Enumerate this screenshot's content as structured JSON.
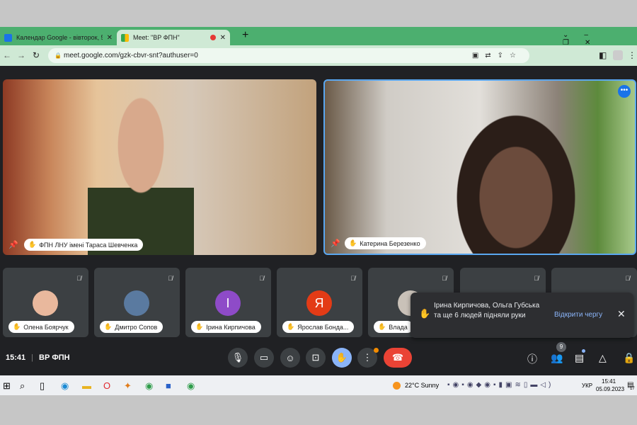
{
  "browser": {
    "tabs": [
      {
        "title": "Календар Google - вівторок, 5 вересн",
        "favicon": "calendar-icon"
      },
      {
        "title": "Meet: \"ВР ФПН\"",
        "favicon": "meet-icon",
        "recording": true
      }
    ],
    "url": "meet.google.com/gzk-cbvr-snt?authuser=0",
    "accent": "#4caf6f"
  },
  "meet": {
    "main": [
      {
        "name": "ФПН ЛНУ імені Тараса Шевченка"
      },
      {
        "name": "Катерина Березенко"
      }
    ],
    "participants": [
      {
        "name": "Олена Боярчук",
        "avatar": "photo"
      },
      {
        "name": "Дмитро Сопов",
        "avatar": "photo"
      },
      {
        "name": "Ірина Кирпичова",
        "initial": "І",
        "color": "#8e4bc8"
      },
      {
        "name": "Ярослав Бонда...",
        "initial": "Я",
        "color": "#e33b16"
      },
      {
        "name": "Влада",
        "avatar": "photo"
      }
    ],
    "toast": {
      "text": "Ірина Кирпичова, Ольга Губська та ще 6 людей підняли руки",
      "action": "Відкрити чергу"
    },
    "time": "15:41",
    "meeting_name": "ВР ФПН",
    "people_count": "9"
  },
  "taskbar": {
    "weather": "22°C  Sunny",
    "lang": "УКР",
    "time": "15:41",
    "date": "05.09.2023",
    "notifications": "17"
  }
}
